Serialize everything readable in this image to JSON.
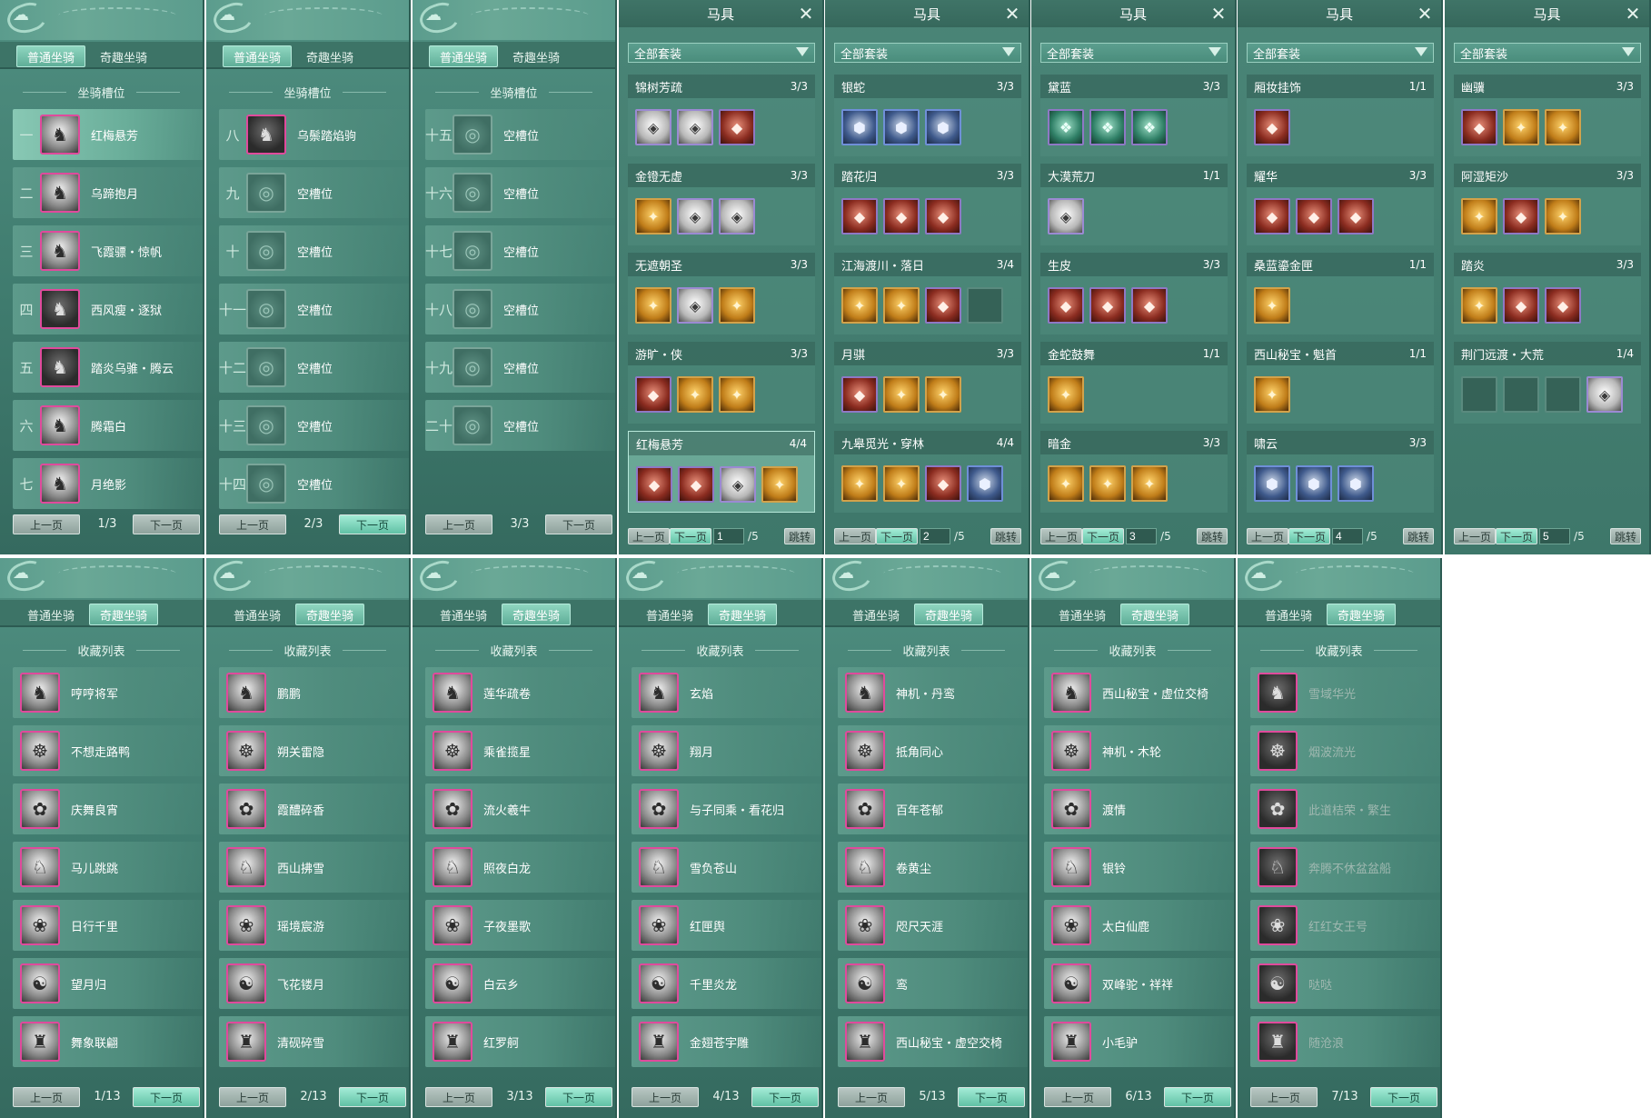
{
  "colors": {
    "panel": "#4f8e80",
    "accent": "#61c1a5",
    "border_purple": "#8f78c5"
  },
  "tabs": {
    "normal": "普通坐骑",
    "fun": "奇趣坐骑"
  },
  "slot_header": "坐骑槽位",
  "collect_header": "收藏列表",
  "pager": {
    "prev": "上一页",
    "next": "下一页"
  },
  "slot_pages": [
    {
      "page": "1/3",
      "slots": [
        {
          "num": "一",
          "name": "红梅悬芳",
          "icon": "white-horse-icon",
          "sel": true,
          "empty": false
        },
        {
          "num": "二",
          "name": "乌蹄抱月",
          "icon": "white-horse-icon",
          "sel": false,
          "empty": false
        },
        {
          "num": "三",
          "name": "飞霞骠・惊帆",
          "icon": "white-horse-icon",
          "sel": false,
          "empty": false
        },
        {
          "num": "四",
          "name": "西风瘦・逐狱",
          "icon": "black-horse-icon",
          "sel": false,
          "empty": false
        },
        {
          "num": "五",
          "name": "踏炎乌骓・腾云",
          "icon": "black-horse-icon",
          "sel": false,
          "empty": false
        },
        {
          "num": "六",
          "name": "腾霜白",
          "icon": "white-horse-icon",
          "sel": false,
          "empty": false
        },
        {
          "num": "七",
          "name": "月绝影",
          "icon": "white-horse-icon",
          "sel": false,
          "empty": false
        }
      ]
    },
    {
      "page": "2/3",
      "slots": [
        {
          "num": "八",
          "name": "乌鬃踏焰驹",
          "icon": "brown-horse-icon",
          "sel": false,
          "empty": false
        },
        {
          "num": "九",
          "name": "空槽位",
          "icon": "empty-slot-icon",
          "sel": false,
          "empty": true
        },
        {
          "num": "十",
          "name": "空槽位",
          "icon": "empty-slot-icon",
          "sel": false,
          "empty": true
        },
        {
          "num": "十一",
          "name": "空槽位",
          "icon": "empty-slot-icon",
          "sel": false,
          "empty": true
        },
        {
          "num": "十二",
          "name": "空槽位",
          "icon": "empty-slot-icon",
          "sel": false,
          "empty": true
        },
        {
          "num": "十三",
          "name": "空槽位",
          "icon": "empty-slot-icon",
          "sel": false,
          "empty": true
        },
        {
          "num": "十四",
          "name": "空槽位",
          "icon": "empty-slot-icon",
          "sel": false,
          "empty": true
        }
      ]
    },
    {
      "page": "3/3",
      "slots": [
        {
          "num": "十五",
          "name": "空槽位",
          "icon": "empty-slot-icon",
          "sel": false,
          "empty": true
        },
        {
          "num": "十六",
          "name": "空槽位",
          "icon": "empty-slot-icon",
          "sel": false,
          "empty": true
        },
        {
          "num": "十七",
          "name": "空槽位",
          "icon": "empty-slot-icon",
          "sel": false,
          "empty": true
        },
        {
          "num": "十八",
          "name": "空槽位",
          "icon": "empty-slot-icon",
          "sel": false,
          "empty": true
        },
        {
          "num": "十九",
          "name": "空槽位",
          "icon": "empty-slot-icon",
          "sel": false,
          "empty": true
        },
        {
          "num": "二十",
          "name": "空槽位",
          "icon": "empty-slot-icon",
          "sel": false,
          "empty": true
        }
      ]
    }
  ],
  "gear": {
    "title": "马具",
    "filter": "全部套装",
    "jump": "跳转",
    "total": "/5",
    "pages": [
      {
        "page_input": "1",
        "sets": [
          {
            "name": "锦树芳疏",
            "count": "3/3",
            "items": [
              "white",
              "white",
              "red"
            ]
          },
          {
            "name": "金镫无虚",
            "count": "3/3",
            "items": [
              "gold",
              "white",
              "white"
            ]
          },
          {
            "name": "无遮朝圣",
            "count": "3/3",
            "items": [
              "gold",
              "white",
              "gold"
            ]
          },
          {
            "name": "游旷・侠",
            "count": "3/3",
            "items": [
              "red",
              "gold",
              "gold"
            ]
          },
          {
            "name": "红梅悬芳",
            "count": "4/4",
            "items": [
              "red",
              "red",
              "white",
              "gold"
            ],
            "sel": true
          }
        ]
      },
      {
        "page_input": "2",
        "sets": [
          {
            "name": "银蛇",
            "count": "3/3",
            "items": [
              "blue",
              "blue",
              "blue"
            ]
          },
          {
            "name": "踏花归",
            "count": "3/3",
            "items": [
              "red",
              "red",
              "red"
            ]
          },
          {
            "name": "江海渡川・落日",
            "count": "3/4",
            "items": [
              "gold",
              "gold",
              "red",
              "empty"
            ]
          },
          {
            "name": "月骐",
            "count": "3/3",
            "items": [
              "red",
              "gold",
              "gold"
            ]
          },
          {
            "name": "九皋觅光・穿林",
            "count": "4/4",
            "items": [
              "gold",
              "gold",
              "red",
              "blue"
            ]
          }
        ]
      },
      {
        "page_input": "3",
        "sets": [
          {
            "name": "黛蓝",
            "count": "3/3",
            "items": [
              "teal",
              "teal",
              "teal"
            ]
          },
          {
            "name": "大漠荒刀",
            "count": "1/1",
            "items": [
              "white"
            ]
          },
          {
            "name": "生皮",
            "count": "3/3",
            "items": [
              "red",
              "red",
              "red"
            ]
          },
          {
            "name": "金蛇鼓舞",
            "count": "1/1",
            "items": [
              "gold"
            ]
          },
          {
            "name": "暗金",
            "count": "3/3",
            "items": [
              "gold",
              "gold",
              "gold"
            ]
          }
        ]
      },
      {
        "page_input": "4",
        "sets": [
          {
            "name": "厢妆挂饰",
            "count": "1/1",
            "items": [
              "red"
            ]
          },
          {
            "name": "耀华",
            "count": "3/3",
            "items": [
              "red",
              "red",
              "red"
            ]
          },
          {
            "name": "桑蓝鎏金匣",
            "count": "1/1",
            "items": [
              "gold"
            ]
          },
          {
            "name": "西山秘宝・魁首",
            "count": "1/1",
            "items": [
              "gold"
            ]
          },
          {
            "name": "啸云",
            "count": "3/3",
            "items": [
              "blue",
              "blue",
              "blue"
            ]
          }
        ]
      },
      {
        "page_input": "5",
        "sets": [
          {
            "name": "幽骥",
            "count": "3/3",
            "items": [
              "red",
              "gold",
              "gold"
            ]
          },
          {
            "name": "阿湿矩沙",
            "count": "3/3",
            "items": [
              "gold",
              "red",
              "gold"
            ]
          },
          {
            "name": "踏炎",
            "count": "3/3",
            "items": [
              "gold",
              "red",
              "red"
            ]
          },
          {
            "name": "荆门远渡・大荒",
            "count": "1/4",
            "items": [
              "empty",
              "empty",
              "empty",
              "white"
            ]
          }
        ]
      }
    ]
  },
  "collect_pages": [
    {
      "page": "1/13",
      "items": [
        {
          "name": "哼哼将军",
          "dim": false
        },
        {
          "name": "不想走路鸭",
          "dim": false
        },
        {
          "name": "庆舞良宵",
          "dim": false
        },
        {
          "name": "马儿跳跳",
          "dim": false
        },
        {
          "name": "日行千里",
          "dim": false
        },
        {
          "name": "望月归",
          "dim": false
        },
        {
          "name": "舞象联翩",
          "dim": false
        }
      ]
    },
    {
      "page": "2/13",
      "items": [
        {
          "name": "鹏鹏",
          "dim": false
        },
        {
          "name": "朔关雷隐",
          "dim": false
        },
        {
          "name": "霞醴碎香",
          "dim": false
        },
        {
          "name": "西山拂雪",
          "dim": false
        },
        {
          "name": "瑶境宸游",
          "dim": false
        },
        {
          "name": "飞花镂月",
          "dim": false
        },
        {
          "name": "清砚碎雪",
          "dim": false
        }
      ]
    },
    {
      "page": "3/13",
      "items": [
        {
          "name": "莲华疏卷",
          "dim": false
        },
        {
          "name": "乘雀揽星",
          "dim": false
        },
        {
          "name": "流火羲牛",
          "dim": false
        },
        {
          "name": "照夜白龙",
          "dim": false
        },
        {
          "name": "子夜墨歌",
          "dim": false
        },
        {
          "name": "白云乡",
          "dim": false
        },
        {
          "name": "红罗舸",
          "dim": false
        }
      ]
    },
    {
      "page": "4/13",
      "items": [
        {
          "name": "玄焰",
          "dim": false
        },
        {
          "name": "翔月",
          "dim": false
        },
        {
          "name": "与子同乘・看花归",
          "dim": false
        },
        {
          "name": "雪负苍山",
          "dim": false
        },
        {
          "name": "红匣舆",
          "dim": false
        },
        {
          "name": "千里炎龙",
          "dim": false
        },
        {
          "name": "金翅苍宇雕",
          "dim": false
        }
      ]
    },
    {
      "page": "5/13",
      "items": [
        {
          "name": "神机・丹鸾",
          "dim": false
        },
        {
          "name": "抵角同心",
          "dim": false
        },
        {
          "name": "百年苍郁",
          "dim": false
        },
        {
          "name": "卷黄尘",
          "dim": false
        },
        {
          "name": "咫尺天涯",
          "dim": false
        },
        {
          "name": "鸾",
          "dim": false
        },
        {
          "name": "西山秘宝・虚空交椅",
          "dim": false
        }
      ]
    },
    {
      "page": "6/13",
      "items": [
        {
          "name": "西山秘宝・虚位交椅",
          "dim": false
        },
        {
          "name": "神机・木轮",
          "dim": false
        },
        {
          "name": "渡情",
          "dim": false
        },
        {
          "name": "银铃",
          "dim": false
        },
        {
          "name": "太白仙鹿",
          "dim": false
        },
        {
          "name": "双峰驼・祥祥",
          "dim": false
        },
        {
          "name": "小毛驴",
          "dim": false
        }
      ]
    },
    {
      "page": "7/13",
      "items": [
        {
          "name": "雪域华光",
          "dim": true
        },
        {
          "name": "烟波流光",
          "dim": true
        },
        {
          "name": "此道桔荣・繁生",
          "dim": true
        },
        {
          "name": "奔腾不休盆盆船",
          "dim": true
        },
        {
          "name": "红红女王号",
          "dim": true
        },
        {
          "name": "哒哒",
          "dim": true
        },
        {
          "name": "随沧浪",
          "dim": true
        }
      ]
    }
  ]
}
